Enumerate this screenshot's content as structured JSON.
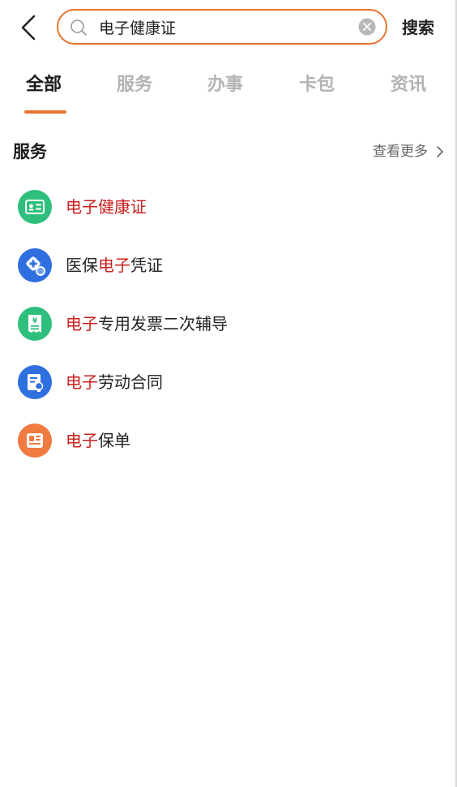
{
  "search": {
    "query": "电子健康证",
    "submit_label": "搜索"
  },
  "tabs": [
    {
      "label": "全部",
      "active": true
    },
    {
      "label": "服务",
      "active": false
    },
    {
      "label": "办事",
      "active": false
    },
    {
      "label": "卡包",
      "active": false
    },
    {
      "label": "资讯",
      "active": false
    }
  ],
  "section": {
    "title": "服务",
    "see_more": "查看更多"
  },
  "services": [
    {
      "before": "",
      "highlight": "电子健康证",
      "after": "",
      "icon": "id-card-icon",
      "color": "#2fbf7d"
    },
    {
      "before": "医保",
      "highlight": "电子",
      "after": "凭证",
      "icon": "medical-insurance-icon",
      "color": "#2f6fe0"
    },
    {
      "before": "",
      "highlight": "电子",
      "after": "专用发票二次辅导",
      "icon": "receipt-icon",
      "color": "#2fbf7d"
    },
    {
      "before": "",
      "highlight": "电子",
      "after": "劳动合同",
      "icon": "contract-icon",
      "color": "#2f6fe0"
    },
    {
      "before": "",
      "highlight": "电子",
      "after": "保单",
      "icon": "policy-icon",
      "color": "#f07a40"
    }
  ],
  "colors": {
    "accent": "#e8742e",
    "highlight": "#c8201e",
    "tab_inactive": "#b3b3b3"
  }
}
